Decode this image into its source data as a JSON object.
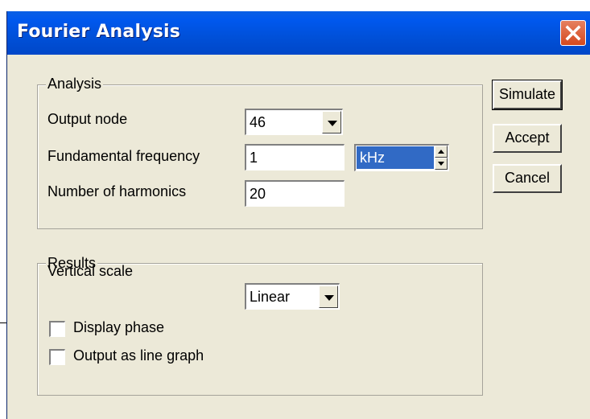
{
  "window": {
    "title": "Fourier Analysis"
  },
  "analysis": {
    "legend": "Analysis",
    "output_node": {
      "label": "Output node",
      "value": "46"
    },
    "fundamental_frequency": {
      "label": "Fundamental frequency",
      "value": "1",
      "unit": "kHz"
    },
    "harmonics": {
      "label": "Number of harmonics",
      "value": "20"
    }
  },
  "results": {
    "legend": "Results",
    "vertical_scale": {
      "label": "Vertical scale",
      "value": "Linear"
    },
    "display_phase": {
      "label": "Display phase",
      "checked": false
    },
    "line_graph": {
      "label": "Output as line graph",
      "checked": false
    }
  },
  "buttons": {
    "simulate": "Simulate",
    "accept": "Accept",
    "cancel": "Cancel"
  },
  "colors": {
    "titlebar": "#0054e3",
    "dialog_bg": "#ece9d8",
    "selection": "#316ac5",
    "close": "#d5491f"
  },
  "icons": {
    "close": "close-icon",
    "dropdown": "chevron-down-icon",
    "spin_up": "arrow-up-icon",
    "spin_down": "arrow-down-icon"
  }
}
